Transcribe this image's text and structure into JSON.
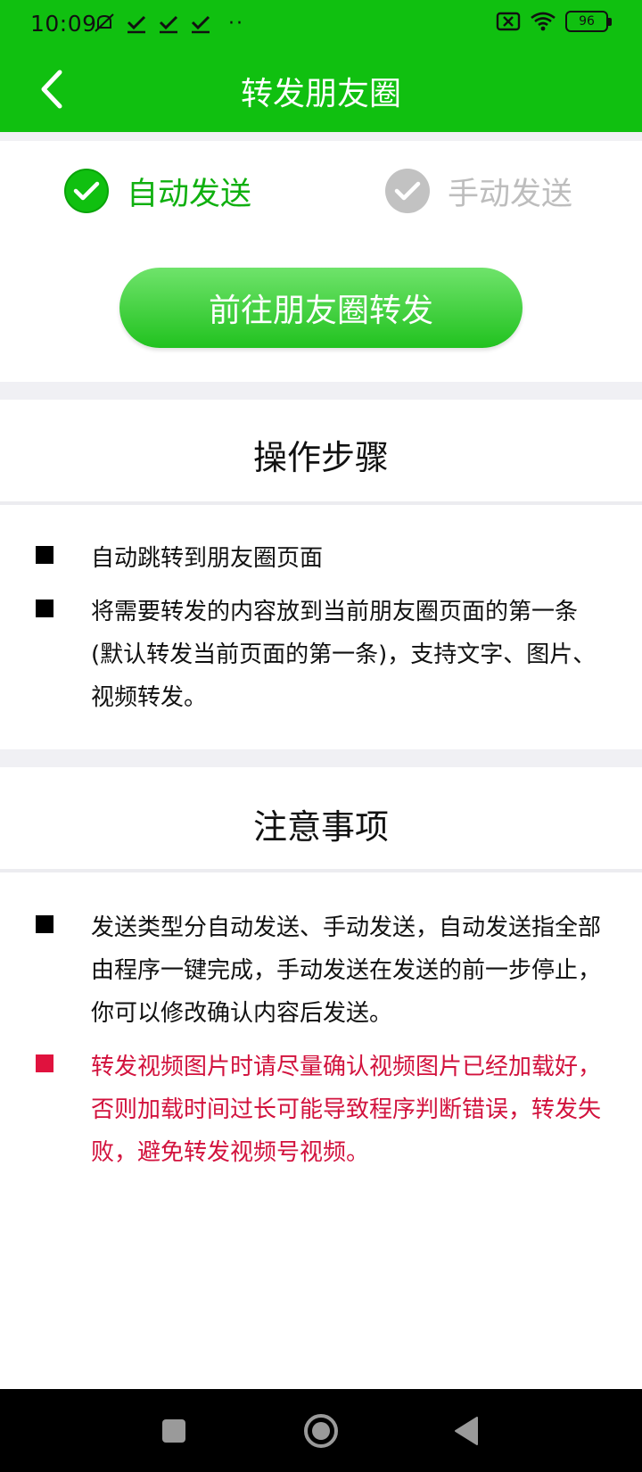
{
  "status_bar": {
    "time": "10:09",
    "dots": "··",
    "battery": "96"
  },
  "header": {
    "title": "转发朋友圈"
  },
  "mode": {
    "auto_label": "自动发送",
    "manual_label": "手动发送",
    "selected": "自动发送"
  },
  "go_button": {
    "label": "前往朋友圈转发"
  },
  "steps": {
    "title": "操作步骤",
    "items": [
      "自动跳转到朋友圈页面",
      "将需要转发的内容放到当前朋友圈页面的第一条(默认转发当前页面的第一条)，支持文字、图片、视频转发。"
    ]
  },
  "notes": {
    "title": "注意事项",
    "items": [
      "发送类型分自动发送、手动发送，自动发送指全部由程序一键完成，手动发送在发送的前一步停止，你可以修改确认内容后发送。",
      "转发视频图片时请尽量确认视频图片已经加载好，否则加载时间过长可能导致程序判断错误，转发失败，避免转发视频号视频。"
    ]
  },
  "colors": {
    "brand_green": "#10c010",
    "warning_red": "#d2123d",
    "inactive_gray": "#bdbdbd"
  },
  "icons": [
    "back-arrow-icon",
    "check-icon",
    "nav-recents-icon",
    "nav-home-icon",
    "nav-back-icon"
  ]
}
